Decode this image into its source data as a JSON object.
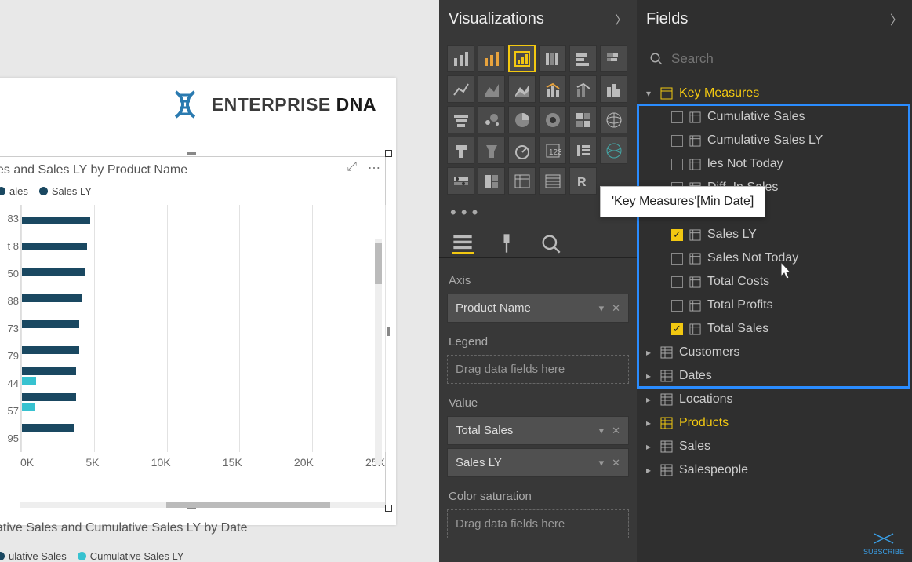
{
  "brand": {
    "prefix": "ENTERPRISE",
    "suffix": " DNA"
  },
  "chart": {
    "title": "es and Sales LY by Product Name",
    "legend": [
      "ales",
      "Sales LY"
    ],
    "toolbar": {
      "focus": "⤢",
      "more": "⋯"
    }
  },
  "chart_data": {
    "type": "bar",
    "orientation": "horizontal",
    "series": [
      {
        "name": "Sales",
        "color": "#1a4861"
      },
      {
        "name": "Sales LY",
        "color": "#37c2d0"
      }
    ],
    "categories": [
      "83",
      "t 8",
      "50",
      "88",
      "73",
      "79",
      "44",
      "57",
      "95"
    ],
    "values_sales": [
      5100,
      4900,
      4700,
      4500,
      4300,
      4300,
      4100,
      4100,
      3900
    ],
    "values_salesly": [
      0,
      0,
      0,
      0,
      0,
      0,
      1100,
      1000,
      0
    ],
    "xticks": [
      "0K",
      "5K",
      "10K",
      "15K",
      "20K",
      "25K"
    ],
    "xlim": [
      0,
      27000
    ]
  },
  "secondChart": {
    "title": "ative Sales and Cumulative Sales LY by Date",
    "legend": [
      "ulative Sales",
      "Cumulative Sales LY"
    ]
  },
  "viz": {
    "title": "Visualizations",
    "more": "• • •",
    "wells": {
      "axis_label": "Axis",
      "axis_value": "Product Name",
      "legend_label": "Legend",
      "legend_placeholder": "Drag data fields here",
      "value_label": "Value",
      "values": [
        "Total Sales",
        "Sales LY"
      ],
      "colorsat_label": "Color saturation",
      "colorsat_placeholder": "Drag data fields here"
    }
  },
  "fields": {
    "title": "Fields",
    "search_placeholder": "Search",
    "tooltip": "'Key Measures'[Min Date]",
    "key_measures": {
      "name": "Key Measures",
      "items": [
        {
          "label": "Cumulative Sales",
          "checked": false
        },
        {
          "label": "Cumulative Sales LY",
          "checked": false
        },
        {
          "label": "les Not Today",
          "checked": false,
          "truncated": true
        },
        {
          "label": "Diff. In Sales",
          "checked": false
        },
        {
          "label": "Min Date",
          "checked": false
        },
        {
          "label": "Sales LY",
          "checked": true
        },
        {
          "label": "Sales Not Today",
          "checked": false
        },
        {
          "label": "Total Costs",
          "checked": false
        },
        {
          "label": "Total Profits",
          "checked": false
        },
        {
          "label": "Total Sales",
          "checked": true
        }
      ]
    },
    "tables": [
      {
        "label": "Customers",
        "sel": false
      },
      {
        "label": "Dates",
        "sel": false
      },
      {
        "label": "Locations",
        "sel": false
      },
      {
        "label": "Products",
        "sel": true
      },
      {
        "label": "Sales",
        "sel": false
      },
      {
        "label": "Salespeople",
        "sel": false
      }
    ]
  },
  "subscribe": "SUBSCRIBE"
}
